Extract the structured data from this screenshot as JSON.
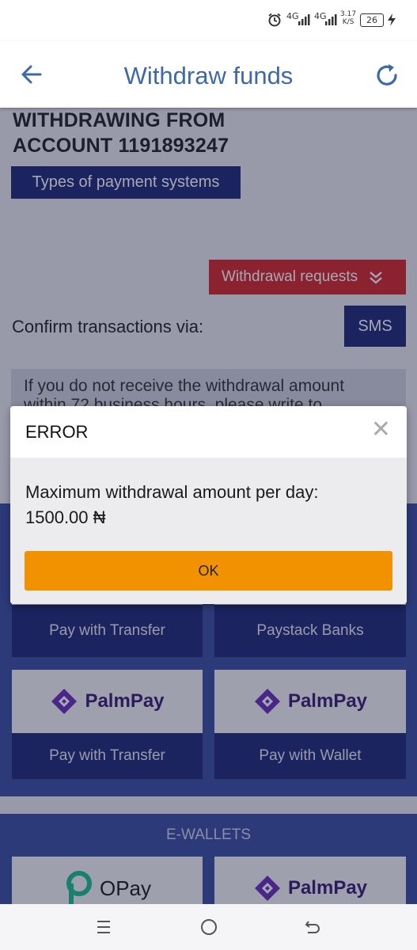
{
  "status_bar": {
    "network1": "4G",
    "network2": "4G",
    "speed": "3.17",
    "speed_unit": "K/S",
    "battery": "26"
  },
  "header": {
    "title": "Withdraw funds"
  },
  "account": {
    "heading_line1": "WITHDRAWING FROM",
    "heading_line2": "ACCOUNT 1191893247",
    "types_button": "Types of payment systems",
    "withdrawal_requests": "Withdrawal requests",
    "confirm_label": "Confirm transactions via:",
    "sms_button": "SMS",
    "info_line1": "If you do not receive the withdrawal amount",
    "info_line2": "within 72 business hours, please write to"
  },
  "payment_cards": [
    {
      "label": "Pay with Transfer"
    },
    {
      "label": "Paystack Banks"
    },
    {
      "logo": "PalmPay",
      "label": "Pay with Transfer"
    },
    {
      "logo": "PalmPay",
      "label": "Pay with Wallet"
    }
  ],
  "ewallets": {
    "title": "E-WALLETS",
    "cards": [
      {
        "logo": "OPay"
      },
      {
        "logo": "PalmPay"
      }
    ]
  },
  "modal": {
    "title": "ERROR",
    "message_line1": "Maximum withdrawal amount per day:",
    "message_line2": "1500.00 ₦",
    "ok_label": "OK"
  },
  "colors": {
    "header_title": "#3d6aa6",
    "navy": "#1f2b73",
    "red": "#d32727",
    "orange": "#f39200",
    "section_blue": "#3d4ea0"
  }
}
